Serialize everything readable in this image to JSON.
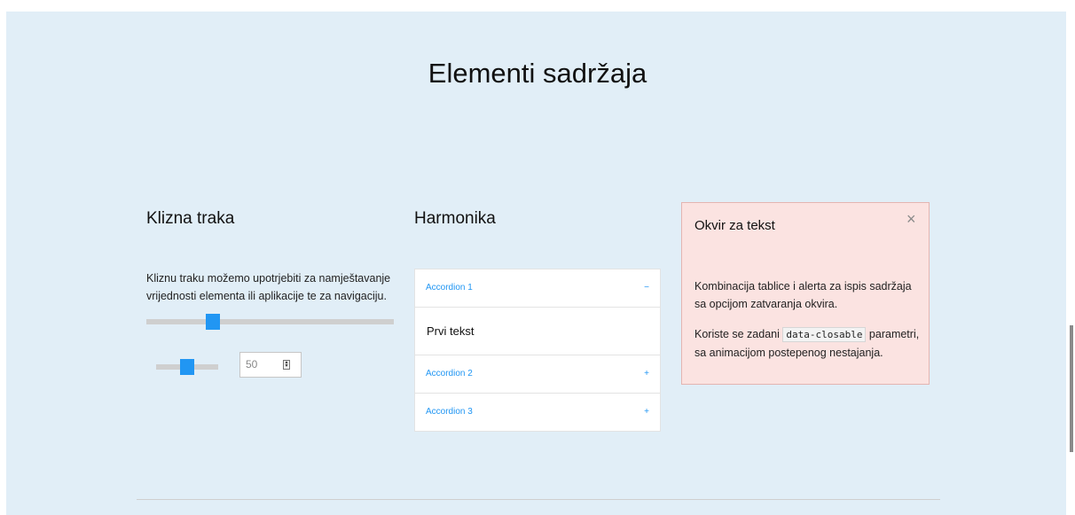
{
  "page": {
    "title": "Elementi sadržaja"
  },
  "slider_section": {
    "heading": "Klizna traka",
    "description": "Kliznu traku možemo upotrjebiti za namještavanje vrijednosti elementa ili aplikacije te za navigaciju.",
    "main_slider_value": 0.27,
    "small_slider_value": 0.5,
    "number_input_value": "50",
    "accent_color": "#2196f3"
  },
  "accordion_section": {
    "heading": "Harmonika",
    "items": [
      {
        "label": "Accordion 1",
        "sign": "−",
        "content": "Prvi tekst",
        "expanded": true
      },
      {
        "label": "Accordion 2",
        "sign": "+",
        "expanded": false
      },
      {
        "label": "Accordion 3",
        "sign": "+",
        "expanded": false
      }
    ]
  },
  "callout": {
    "title": "Okvir za tekst",
    "close_symbol": "×",
    "paragraph1": "Kombinacija tablice i alerta za ispis sadržaja sa opcijom zatvaranja okvira.",
    "paragraph2_before": "Koriste se zadani ",
    "paragraph2_code": "data-closable",
    "paragraph2_after": " parametri, sa animacijom postepenog nestajanja.",
    "background_color": "#fbe3e1"
  },
  "icons": {
    "close": "close-icon",
    "spinner": "spinner-arrows-icon"
  }
}
